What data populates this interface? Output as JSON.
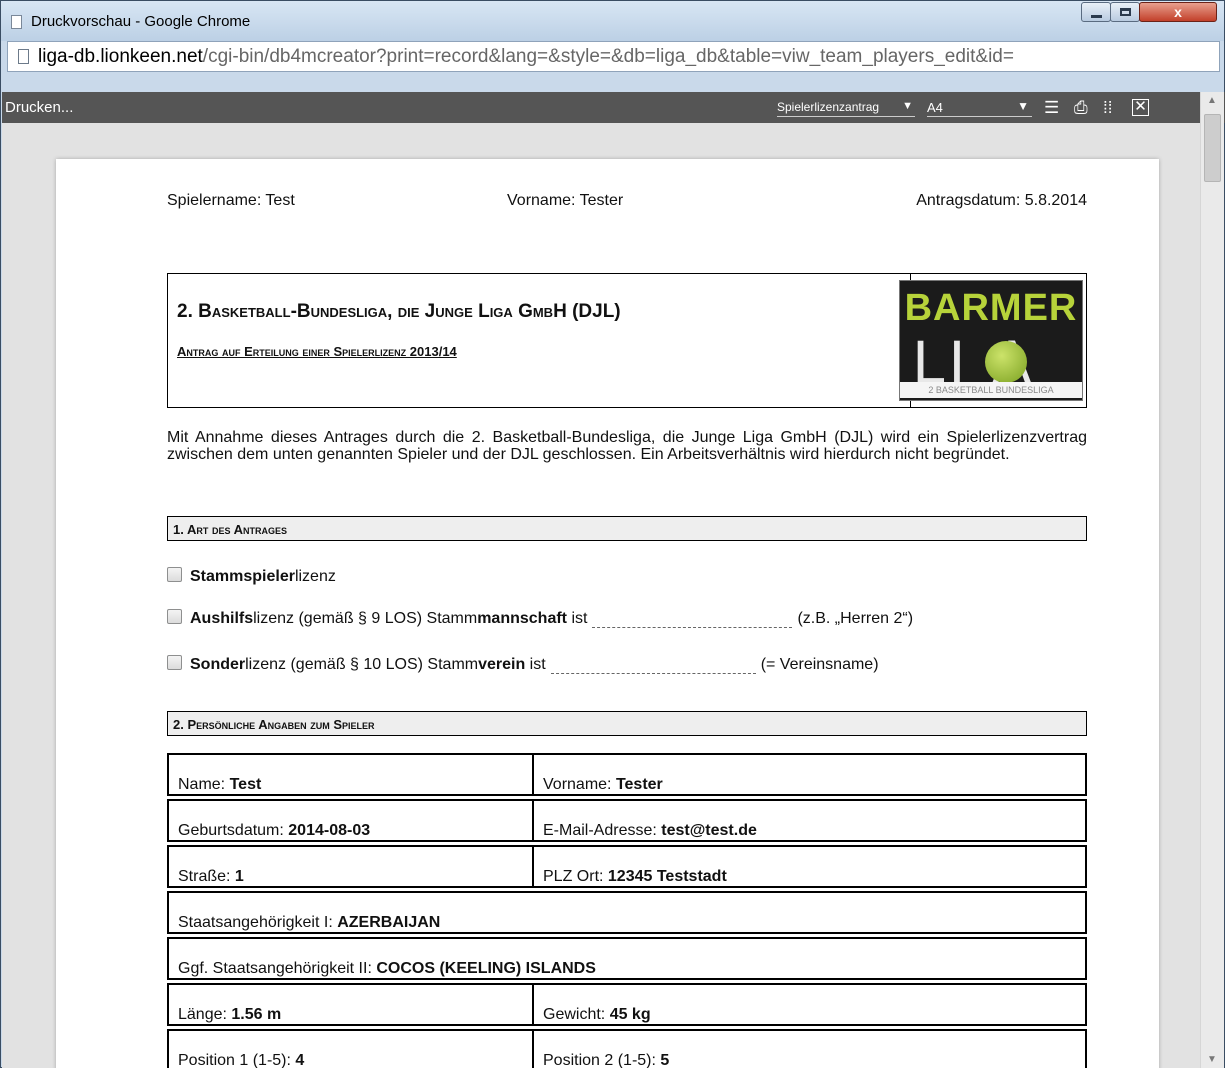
{
  "window": {
    "title": "Druckvorschau - Google Chrome",
    "close_glyph": "x"
  },
  "address_bar": {
    "host": "liga-db.lionkeen.net",
    "path": "/cgi-bin/db4mcreator?print=record&lang=&style=&db=liga_db&table=viw_team_players_edit&id="
  },
  "print_toolbar": {
    "print_label": "Drucken...",
    "template_select": "Spielerlizenzantrag",
    "paper_select": "A4"
  },
  "document": {
    "player_name": "Spielername: Test",
    "first_name": "Vorname: Tester",
    "request_date": "Antragsdatum: 5.8.2014",
    "title": "2. Basketball-Bundesliga, die Junge Liga GmbH (DJL)",
    "subtitle": "Antrag auf Erteilung einer Spielerlizenz 2013/14",
    "logo": {
      "line1": "BARMER",
      "line2": "LI  A",
      "line3": "2 BASKETBALL BUNDESLIGA"
    },
    "intro": "Mit Annahme dieses Antrages durch die 2. Basketball-Bundesliga, die Junge Liga GmbH (DJL) wird ein Spielerlizenzvertrag zwischen dem unten genannten Spieler und der DJL geschlossen. Ein Arbeitsverhältnis wird hierdurch nicht begründet.",
    "section1": "1. Art des Antrages",
    "options": {
      "stamm_bold": "Stammspieler",
      "stamm_rest": "lizenz",
      "aushilf_bold": "Aushilfs",
      "aushilf_mid": "lizenz (gemäß § 9 LOS) Stamm",
      "aushilf_bold2": "mannschaft",
      "aushilf_ist": " ist",
      "aushilf_hint": "(z.B. „Herren 2“)",
      "sonder_bold": "Sonder",
      "sonder_mid": "lizenz (gemäß § 10 LOS) Stamm",
      "sonder_bold2": "verein",
      "sonder_ist": " ist",
      "sonder_hint": "(= Vereinsname)"
    },
    "section2": "2. Persönliche Angaben zum Spieler",
    "fields": {
      "name_label": "Name: ",
      "name_value": "Test",
      "vorname_label": "Vorname: ",
      "vorname_value": "Tester",
      "geburt_label": "Geburtsdatum: ",
      "geburt_value": "2014-08-03",
      "email_label": "E-Mail-Adresse: ",
      "email_value": "test@test.de",
      "strasse_label": "Straße: ",
      "strasse_value": "1",
      "plz_label": "PLZ Ort: ",
      "plz_value": "12345 Teststadt",
      "staat1_label": "Staatsangehörigkeit I: ",
      "staat1_value": "AZERBAIJAN",
      "staat2_label": "Ggf. Staatsangehörigkeit II: ",
      "staat2_value": "COCOS (KEELING) ISLANDS",
      "laenge_label": "Länge: ",
      "laenge_value": "1.56 m",
      "gewicht_label": "Gewicht: ",
      "gewicht_value": "45 kg",
      "pos1_label": "Position 1 (1-5): ",
      "pos1_value": "4",
      "pos2_label": "Position 2 (1-5): ",
      "pos2_value": "5"
    }
  }
}
